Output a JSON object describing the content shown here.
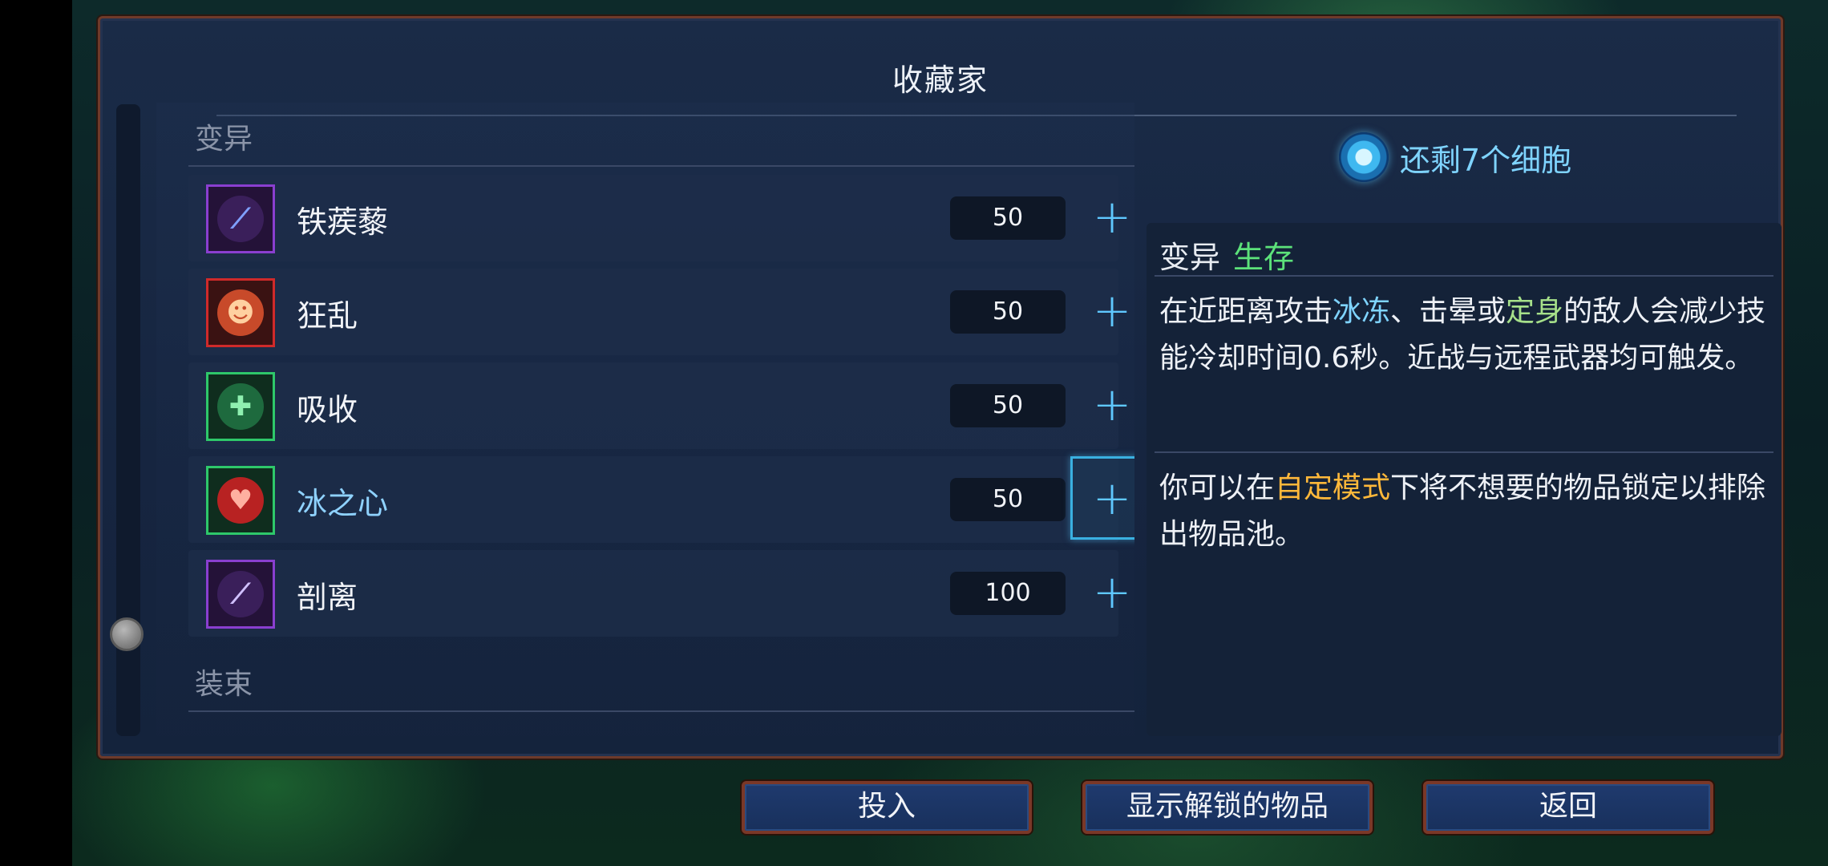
{
  "panel": {
    "title": "收藏家"
  },
  "sections": {
    "mutations": "变异",
    "outfits": "装束"
  },
  "items": [
    {
      "name": "铁蒺藜",
      "cost": "50",
      "frame": "purple",
      "icon": "caltrops-icon"
    },
    {
      "name": "狂乱",
      "cost": "50",
      "frame": "red",
      "icon": "frenzy-icon"
    },
    {
      "name": "吸收",
      "cost": "50",
      "frame": "green",
      "icon": "absorption-icon"
    },
    {
      "name": "冰之心",
      "cost": "50",
      "frame": "green",
      "icon": "ice-heart-icon",
      "selected": true
    },
    {
      "name": "剖离",
      "cost": "100",
      "frame": "purple",
      "icon": "dissection-icon"
    }
  ],
  "plus_label": "+",
  "cells": {
    "text": "还剩7个细胞",
    "icon": "cell-icon"
  },
  "detail": {
    "category": "变异",
    "tag": "生存",
    "desc_parts": [
      "在近距离攻击",
      "冰冻",
      "、击晕或",
      "定身",
      "的敌人会减少技能冷却时间0.6秒。近战与远程武器均可触发。"
    ],
    "tip_parts": [
      "你可以在",
      "自定模式",
      "下将不想要的物品锁定以排除出物品池。"
    ]
  },
  "buttons": {
    "invest": "投入",
    "show_unlocked": "显示解锁的物品",
    "back": "返回"
  },
  "colors": {
    "accent_cyan": "#7fd4ff",
    "tag_green": "#5ce27a",
    "keyword_orange": "#ffb83a",
    "frame_purple": "#8a3fd0",
    "frame_red": "#d02a2a",
    "frame_green": "#2ec86a"
  }
}
